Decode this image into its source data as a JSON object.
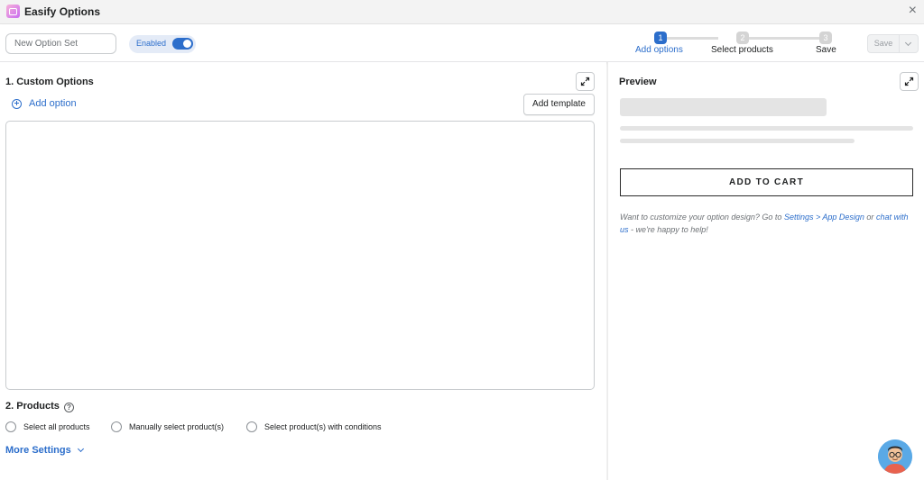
{
  "window": {
    "title": "Easify Options",
    "close_symbol": "×"
  },
  "toolbar": {
    "name_placeholder": "New Option Set",
    "enabled_label": "Enabled",
    "steps": [
      {
        "number": "1",
        "label": "Add options"
      },
      {
        "number": "2",
        "label": "Select products"
      },
      {
        "number": "3",
        "label": "Save"
      }
    ],
    "save_label": "Save"
  },
  "custom_options": {
    "title": "1. Custom Options",
    "add_option_label": "Add option",
    "add_template_label": "Add template"
  },
  "products": {
    "title": "2. Products",
    "help_symbol": "?",
    "radios": [
      {
        "label": "Select all products"
      },
      {
        "label": "Manually select product(s)"
      },
      {
        "label": "Select product(s) with conditions"
      }
    ]
  },
  "more_settings": {
    "label": "More Settings"
  },
  "preview": {
    "title": "Preview",
    "cart_button_label": "ADD TO CART",
    "note_prefix": "Want to customize your option design? Go to ",
    "note_link1": "Settings > App Design",
    "note_middle": " or ",
    "note_link2": "chat with us",
    "note_suffix": " - we're happy to help!"
  },
  "colors": {
    "accent": "#2c6ecb",
    "toggle_on": "#2c6ecb",
    "skeleton": "#e4e4e4"
  },
  "icons": {
    "close": "close-icon",
    "expand": "expand-icon",
    "add": "plus-circle-icon",
    "help": "help-circle-icon",
    "chevron": "chevron-down-icon"
  }
}
